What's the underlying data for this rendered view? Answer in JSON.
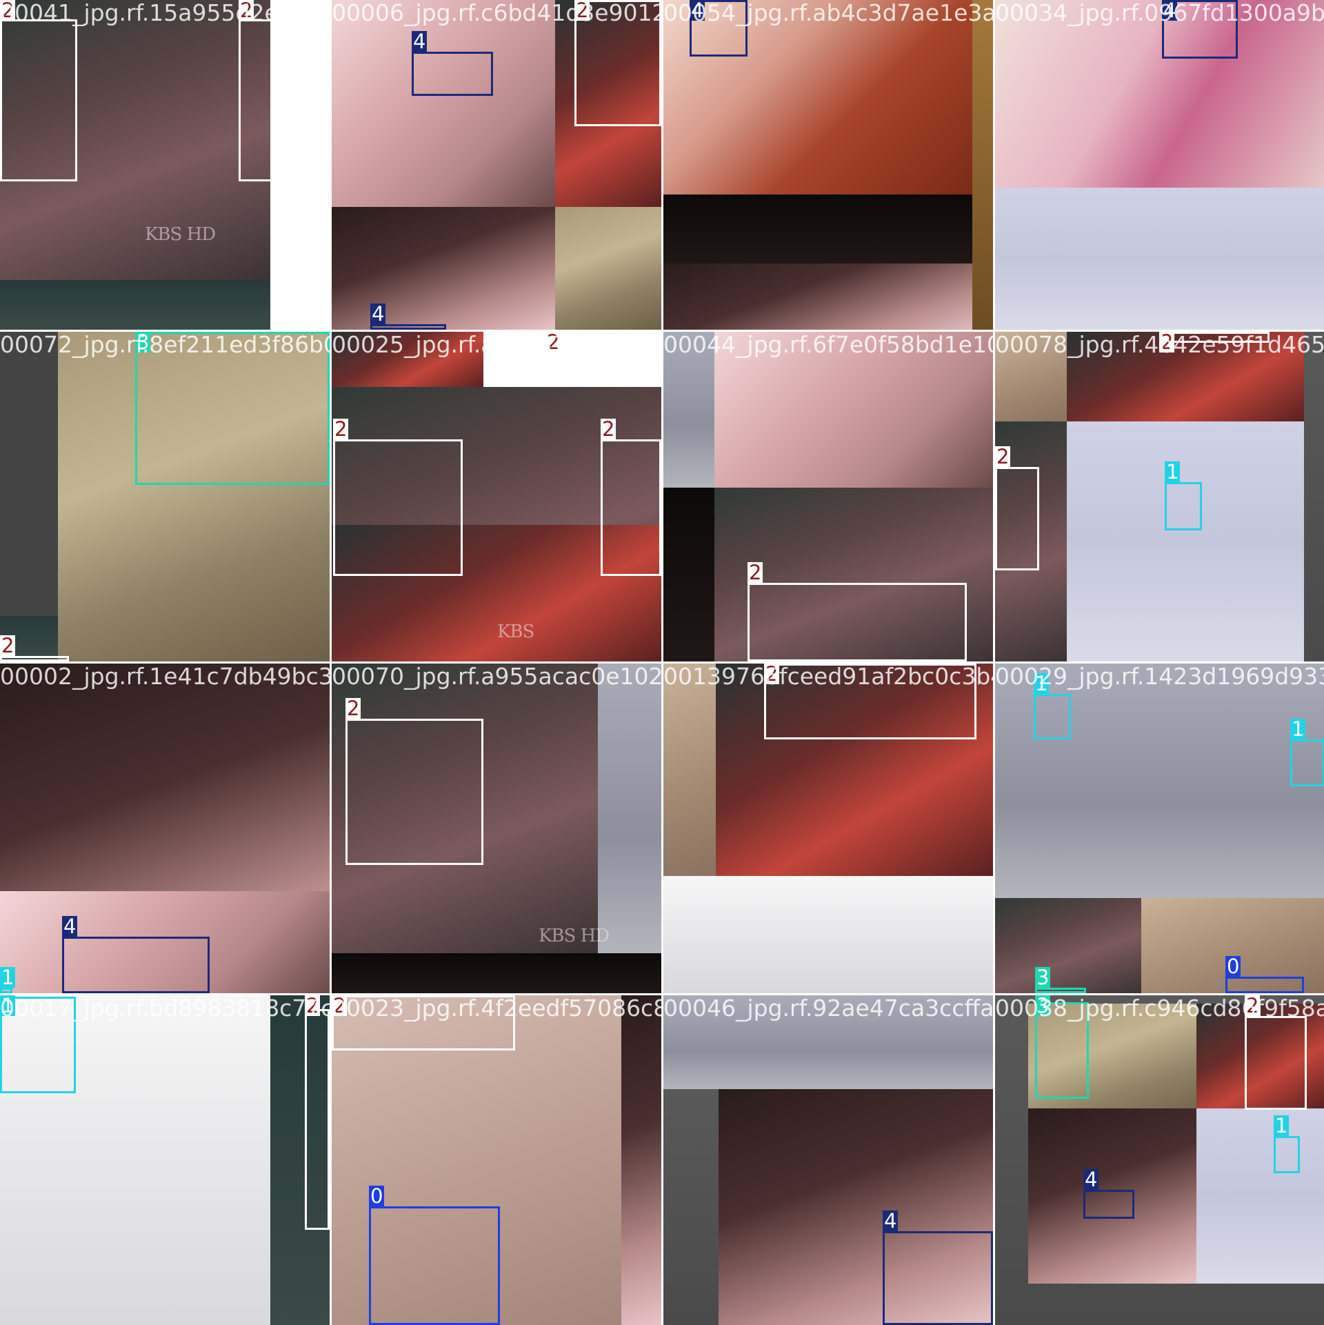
{
  "mosaic": {
    "tiles": [
      {
        "filename": "00041_jpg.rf.15a955d2e48f8aa006c0bc49f66901b47944b54",
        "regions": [
          {
            "k": "coral-dark",
            "r": [
              0,
              0,
              392,
              406
            ]
          },
          {
            "k": "coral-grey",
            "r": [
              0,
              406,
              392,
              72
            ]
          }
        ],
        "logos": [
          {
            "text": "KBS",
            "hd": "HD",
            "r": [
              210,
              325
            ]
          }
        ],
        "boxes": [
          {
            "cls": "2",
            "r": [
              0,
              28,
              112,
              235
            ]
          },
          {
            "cls": "2",
            "r": [
              346,
              28,
              132,
              235
            ]
          }
        ]
      },
      {
        "filename": "00006_jpg.rf.c6bd41d3e9012c88d1f59a3ad6f4e54d2bc5",
        "regions": [
          {
            "k": "orchid",
            "r": [
              0,
              0,
              324,
              300
            ]
          },
          {
            "k": "coral-red",
            "r": [
              324,
              0,
              154,
              300
            ]
          },
          {
            "k": "orchid-dark",
            "r": [
              0,
              300,
              324,
              178
            ]
          },
          {
            "k": "grass",
            "r": [
              324,
              300,
              154,
              178
            ]
          }
        ],
        "logos": [],
        "boxes": [
          {
            "cls": "4",
            "r": [
              116,
              75,
              118,
              64
            ]
          },
          {
            "cls": "2",
            "r": [
              352,
              0,
              126,
              183
            ]
          },
          {
            "cls": "4",
            "r": [
              56,
              470,
              110,
              8
            ]
          }
        ]
      },
      {
        "filename": "00054_jpg.rf.ab4c3d7ae1e3a0a5e921712c0b8d70f6b9",
        "regions": [
          {
            "k": "orchid-bud",
            "r": [
              0,
              0,
              448,
              282
            ]
          },
          {
            "k": "black",
            "r": [
              0,
              282,
              448,
              100
            ]
          },
          {
            "k": "orchid-dark",
            "r": [
              0,
              382,
              478,
              96
            ]
          },
          {
            "k": "amber",
            "r": [
              448,
              0,
              30,
              478
            ]
          }
        ],
        "logos": [],
        "boxes": [
          {
            "cls": "4",
            "r": [
              38,
              0,
              84,
              82
            ]
          }
        ],
        "tags": [
          {
            "cls": "4",
            "r": [
              36,
              0
            ]
          }
        ]
      },
      {
        "filename": "00034_jpg.rf.0967fd1300a9b6ccd0f4e2a7",
        "regions": [
          {
            "k": "orchid-close",
            "r": [
              0,
              0,
              478,
              272
            ]
          },
          {
            "k": "snow-blue",
            "r": [
              0,
              272,
              478,
              206
            ]
          }
        ],
        "logos": [],
        "boxes": [
          {
            "cls": "4",
            "r": [
              242,
              0,
              110,
              85
            ]
          }
        ]
      },
      {
        "filename": "00072_jpg.rf.8ef211ed3f86b00092ce48fa2be379d7ee2d6",
        "regions": [
          {
            "k": "dark-rock",
            "r": [
              0,
              0,
              84,
              478
            ]
          },
          {
            "k": "grass",
            "r": [
              84,
              0,
              394,
              478
            ]
          },
          {
            "k": "coral-grey",
            "r": [
              0,
              412,
              84,
              66
            ]
          }
        ],
        "logos": [],
        "boxes": [
          {
            "cls": "3",
            "r": [
              196,
              0,
              282,
              222
            ]
          },
          {
            "cls": "2",
            "r": [
              0,
              470,
              100,
              8
            ]
          }
        ]
      },
      {
        "filename": "00025_jpg.rf.a2be379d7ee2d6b0443e74e6f7e0f58bd1",
        "regions": [
          {
            "k": "coral-red",
            "r": [
              0,
              0,
              220,
              80
            ]
          },
          {
            "k": "coral-dark",
            "r": [
              0,
              80,
              478,
              398
            ]
          },
          {
            "k": "coral-red",
            "r": [
              0,
              280,
              478,
              198
            ]
          }
        ],
        "logos": [
          {
            "text": "KBS",
            "hd": "",
            "r": [
              240,
              420
            ]
          }
        ],
        "boxes": [
          {
            "cls": "2",
            "r": [
              2,
              156,
              188,
              198
            ]
          },
          {
            "cls": "2",
            "r": [
              390,
              156,
              88,
              198
            ]
          },
          {
            "cls": "2",
            "r": [
              310,
              0,
              168,
              40
            ]
          }
        ]
      },
      {
        "filename": "00044_jpg.rf.6f7e0f58bd1e107bd0e4785f9a1b42e59f1d",
        "regions": [
          {
            "k": "snow-grey",
            "r": [
              0,
              0,
              74,
              226
            ]
          },
          {
            "k": "orchid",
            "r": [
              74,
              0,
              404,
              226
            ]
          },
          {
            "k": "black",
            "r": [
              0,
              226,
              74,
              252
            ]
          },
          {
            "k": "coral-dark",
            "r": [
              74,
              226,
              404,
              252
            ]
          }
        ],
        "logos": [],
        "boxes": [
          {
            "cls": "2",
            "r": [
              122,
              364,
              318,
              114
            ]
          }
        ]
      },
      {
        "filename": "00078_jpg.rf.4b42e59f1d465a3c8e91d0a2f7b",
        "regions": [
          {
            "k": "sand",
            "r": [
              0,
              0,
              104,
              130
            ]
          },
          {
            "k": "coral-red",
            "r": [
              104,
              0,
              344,
              130
            ]
          },
          {
            "k": "coral-dark",
            "r": [
              0,
              130,
              104,
              348
            ]
          },
          {
            "k": "snow-blue",
            "r": [
              104,
              130,
              344,
              348
            ]
          },
          {
            "k": "grey",
            "r": [
              448,
              0,
              30,
              478
            ]
          }
        ],
        "logos": [],
        "boxes": [
          {
            "cls": "2",
            "r": [
              0,
              196,
              64,
              150
            ]
          },
          {
            "cls": "1",
            "r": [
              246,
              218,
              54,
              70
            ]
          },
          {
            "cls": "2",
            "r": [
              238,
              0,
              160,
              16
            ]
          }
        ]
      },
      {
        "filename": "00002_jpg.rf.1e41c7db49bc3e6070a109fa955acac0e1025",
        "regions": [
          {
            "k": "orchid-dark",
            "r": [
              0,
              0,
              478,
              478
            ]
          },
          {
            "k": "orchid",
            "r": [
              0,
              330,
              478,
              148
            ]
          }
        ],
        "logos": [],
        "boxes": [
          {
            "cls": "4",
            "r": [
              90,
              396,
              214,
              82
            ]
          },
          {
            "cls": "1",
            "r": [
              0,
              470,
              18,
              8
            ]
          }
        ]
      },
      {
        "filename": "00070_jpg.rf.a955acac0e1025b0139766fceed91af2bc0c",
        "regions": [
          {
            "k": "coral-dark",
            "r": [
              0,
              0,
              386,
              420
            ]
          },
          {
            "k": "snow-grey",
            "r": [
              386,
              0,
              92,
              420
            ]
          },
          {
            "k": "black",
            "r": [
              0,
              420,
              478,
              58
            ]
          }
        ],
        "logos": [
          {
            "text": "KBS",
            "hd": "HD",
            "r": [
              300,
              380
            ]
          }
        ],
        "boxes": [
          {
            "cls": "2",
            "r": [
              20,
              80,
              200,
              212
            ]
          }
        ]
      },
      {
        "filename": "00139766fceed91af2bc0c3b4291423d1969",
        "regions": [
          {
            "k": "sand",
            "r": [
              0,
              0,
              76,
              308
            ]
          },
          {
            "k": "coral-red",
            "r": [
              76,
              0,
              402,
              308
            ]
          },
          {
            "k": "snow-white",
            "r": [
              0,
              308,
              478,
              170
            ]
          }
        ],
        "logos": [],
        "boxes": [
          {
            "cls": "2",
            "r": [
              146,
              0,
              308,
              110
            ]
          }
        ]
      },
      {
        "filename": "00029_jpg.rf.1423d1969d933faf0e2c3",
        "regions": [
          {
            "k": "snow-grey",
            "r": [
              0,
              0,
              478,
              340
            ]
          },
          {
            "k": "coral-dark",
            "r": [
              0,
              340,
              212,
              138
            ]
          },
          {
            "k": "sand",
            "r": [
              212,
              340,
              266,
              138
            ]
          }
        ],
        "logos": [],
        "boxes": [
          {
            "cls": "1",
            "r": [
              56,
              44,
              54,
              66
            ]
          },
          {
            "cls": "1",
            "r": [
              428,
              110,
              50,
              68
            ]
          },
          {
            "cls": "0",
            "r": [
              334,
              454,
              114,
              24
            ]
          },
          {
            "cls": "3",
            "r": [
              58,
              470,
              74,
              8
            ]
          }
        ]
      },
      {
        "filename": "00017_jpg.rf.bd8983818c77ca00623186ef4f2eedf57",
        "regions": [
          {
            "k": "snow-white",
            "r": [
              0,
              0,
              392,
              478
            ]
          },
          {
            "k": "coral-grey",
            "r": [
              392,
              0,
              86,
              478
            ]
          }
        ],
        "logos": [],
        "boxes": [
          {
            "cls": "1",
            "r": [
              0,
              2,
              110,
              140
            ]
          },
          {
            "cls": "2",
            "r": [
              442,
              20,
              36,
              320
            ]
          }
        ]
      },
      {
        "filename": "00023_jpg.rf.4f2eedf57086c88f0149c92ae47ca3ccf",
        "regions": [
          {
            "k": "sand-pink",
            "r": [
              0,
              0,
              420,
              478
            ]
          },
          {
            "k": "orchid-dark",
            "r": [
              420,
              0,
              58,
              478
            ]
          }
        ],
        "logos": [],
        "boxes": [
          {
            "cls": "0",
            "r": [
              54,
              306,
              190,
              172
            ]
          },
          {
            "cls": "2",
            "r": [
              0,
              0,
              266,
              80
            ]
          }
        ]
      },
      {
        "filename": "00046_jpg.rf.92ae47ca3ccffa90a09338c2b94f6c8f",
        "regions": [
          {
            "k": "snow-grey",
            "r": [
              0,
              0,
              478,
              136
            ]
          },
          {
            "k": "orchid-dark",
            "r": [
              80,
              136,
              398,
              342
            ]
          },
          {
            "k": "grey",
            "r": [
              0,
              136,
              80,
              342
            ]
          }
        ],
        "logos": [],
        "boxes": [
          {
            "cls": "4",
            "r": [
              318,
              342,
              160,
              136
            ]
          }
        ]
      },
      {
        "filename": "00038_jpg.rf.c946cd86f9f58aca5",
        "regions": [
          {
            "k": "grey",
            "r": [
              0,
              0,
              478,
              478
            ]
          },
          {
            "k": "grass",
            "r": [
              48,
              12,
              294,
              152
            ]
          },
          {
            "k": "coral-red",
            "r": [
              292,
              12,
              186,
              152
            ]
          },
          {
            "k": "orchid-dark",
            "r": [
              48,
              164,
              244,
              254
            ]
          },
          {
            "k": "snow-blue",
            "r": [
              292,
              164,
              186,
              254
            ]
          }
        ],
        "logos": [],
        "boxes": [
          {
            "cls": "3",
            "r": [
              58,
              10,
              78,
              140
            ]
          },
          {
            "cls": "2",
            "r": [
              362,
              30,
              90,
              136
            ]
          },
          {
            "cls": "1",
            "r": [
              404,
              204,
              38,
              54
            ]
          },
          {
            "cls": "4",
            "r": [
              128,
              282,
              74,
              42
            ]
          }
        ]
      }
    ]
  },
  "class_colors": {
    "0": "#1d3ee0",
    "1": "#22d3e6",
    "2": "#ffffff",
    "3": "#1fd7b0",
    "4": "#1a2a7a"
  },
  "tag_colors": {
    "0": "#1d3ee0",
    "1": "#22d3e6",
    "2": "#ffffff",
    "3": "#1fd7b0",
    "4": "#1a2a7a"
  },
  "tag_text_colors": {
    "0": "#ffffff",
    "1": "#ffffff",
    "2": "#8a1a1a",
    "3": "#ffffff",
    "4": "#ffffff"
  },
  "region_colors": {
    "coral-dark": "linear-gradient(160deg,#2f3a36 0%,#5a4444 35%,#7b5a5c 60%,#3b3334 100%)",
    "coral-grey": "linear-gradient(180deg,#273a3a 0%,#3a4a47 100%)",
    "coral-red": "linear-gradient(150deg,#2a3232 0%,#6b2c2a 40%,#c2453a 65%,#5a2120 100%)",
    "orchid": "linear-gradient(135deg,#f3d6d8 0%,#d7a6a8 40%,#b7888a 70%,#6a4a4a 100%)",
    "orchid-dark": "linear-gradient(160deg,#2a1c1c 0%,#4a2f2f 40%,#b68a88 75%,#e8c3c6 100%)",
    "orchid-bud": "linear-gradient(135deg,#f2d8cc 0%,#d69a8a 35%,#a8452a 60%,#7a2a18 100%)",
    "orchid-close": "linear-gradient(120deg,#f0e0da 0%,#e7b4c2 40%,#c9668d 60%,#e6c7c7 100%)",
    "grass": "linear-gradient(160deg,#a89a78 0%,#c4b592 40%,#8e8164 70%,#6e6048 100%)",
    "snow-blue": "linear-gradient(180deg,#cfd1e6 0%,#c4c6db 50%,#d9dbe9 100%)",
    "snow-grey": "linear-gradient(180deg,#a9acb8 0%,#8d909c 60%,#b3b5bd 100%)",
    "snow-white": "linear-gradient(180deg,#f6f6f7 0%,#e4e4e6 60%,#d9d9db 100%)",
    "sand": "linear-gradient(160deg,#c9b298 0%,#a38972 60%,#8a7260 100%)",
    "sand-pink": "linear-gradient(160deg,#d6bcb2 0%,#b89a8e 60%,#a3857a 100%)",
    "black": "linear-gradient(180deg,#0c0a09 0%,#1f1715 100%)",
    "amber": "linear-gradient(180deg,#a6793a 0%,#6e4d22 100%)",
    "grey": "linear-gradient(180deg,#595959 0%,#4a4a4a 100%)"
  }
}
